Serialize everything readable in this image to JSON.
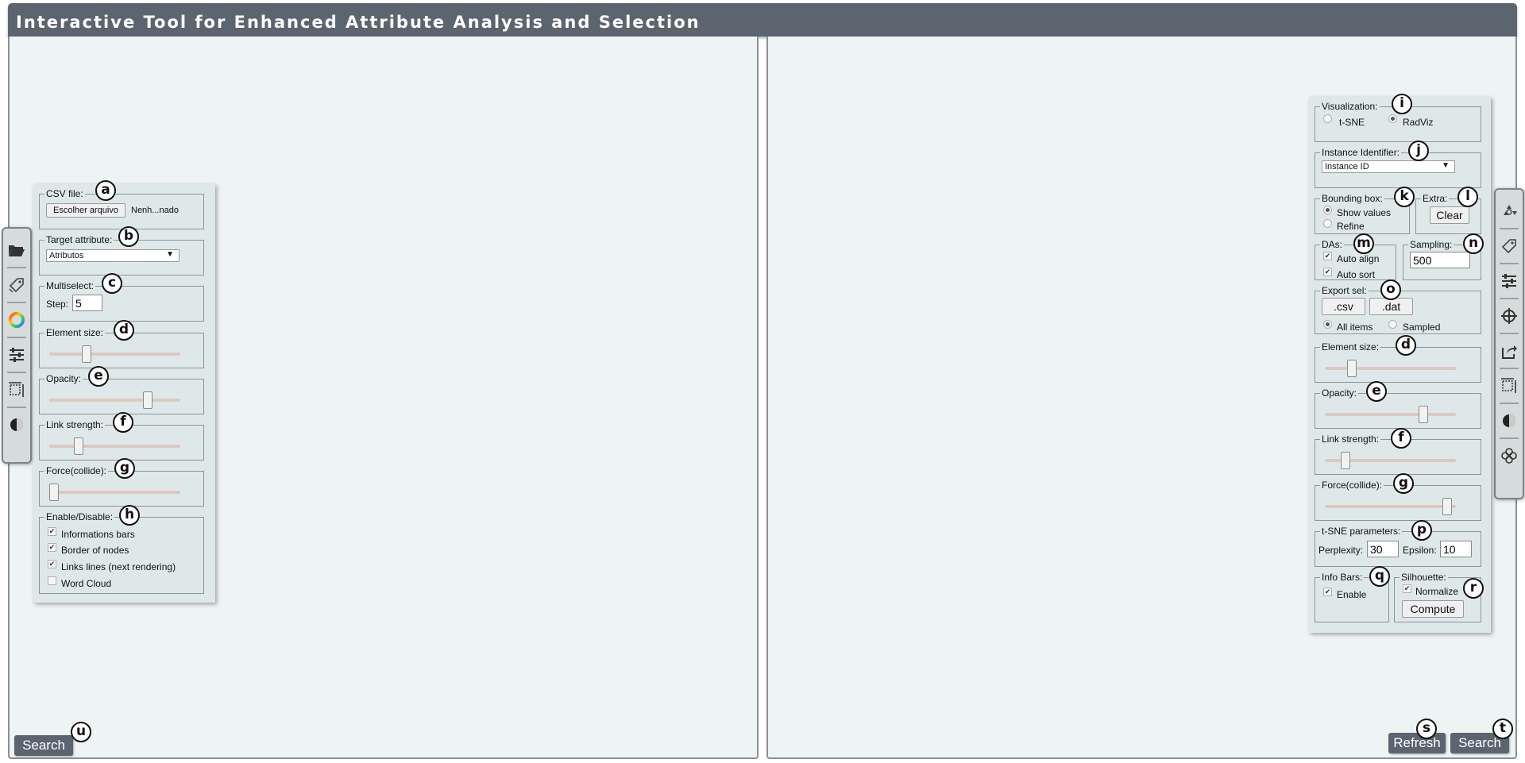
{
  "app": {
    "title": "Interactive Tool for Enhanced Attribute Analysis and Selection",
    "colors": {
      "titlebar": "#5c6470",
      "panel": "#eef3f3",
      "controls": "#dfe8e8"
    }
  },
  "left_toolbar": {
    "icons": [
      "folder-open-icon",
      "tag-icon",
      "color-wheel-icon",
      "sliders-icon",
      "resize-icon",
      "contrast-icon"
    ]
  },
  "right_toolbar": {
    "icons": [
      "recycle-icon",
      "tag-icon",
      "sliders-icon",
      "crosshair-icon",
      "share-icon",
      "resize-icon",
      "contrast-icon",
      "flower-icon"
    ]
  },
  "left_controls": {
    "csv": {
      "legend": "CSV file:",
      "button": "Escolher arquivo",
      "filename": "Nenh...nado",
      "marker": "a"
    },
    "target": {
      "legend": "Target attribute:",
      "selected": "Atributos",
      "marker": "b"
    },
    "multiselect": {
      "legend": "Multiselect:",
      "step_label": "Step:",
      "step_value": "5",
      "marker": "c"
    },
    "element_size": {
      "legend": "Element size:",
      "level": 0.27,
      "marker": "d"
    },
    "opacity": {
      "legend": "Opacity:",
      "level": 0.77,
      "marker": "e"
    },
    "link_strength": {
      "legend": "Link strength:",
      "level": 0.2,
      "marker": "f"
    },
    "force": {
      "legend": "Force(collide):",
      "level": 0.0,
      "marker": "g"
    },
    "enable": {
      "legend": "Enable/Disable:",
      "marker": "h",
      "items": [
        {
          "label": "Informations bars",
          "checked": true
        },
        {
          "label": "Border of nodes",
          "checked": true
        },
        {
          "label": "Links lines (next rendering)",
          "checked": true
        },
        {
          "label": "Word Cloud",
          "checked": false
        }
      ]
    }
  },
  "right_controls": {
    "visualization": {
      "legend": "Visualization:",
      "marker": "i",
      "options": [
        "t-SNE",
        "RadViz"
      ],
      "selected": "RadViz"
    },
    "instance": {
      "legend": "Instance Identifier:",
      "selected": "Instance ID",
      "marker": "j"
    },
    "bounding": {
      "legend": "Bounding box:",
      "marker": "k",
      "options": [
        "Show values",
        "Refine"
      ],
      "selected": "Show values"
    },
    "extra": {
      "legend": "Extra:",
      "button": "Clear",
      "marker": "l"
    },
    "das": {
      "legend": "DAs:",
      "marker": "m",
      "items": [
        {
          "label": "Auto align",
          "checked": true
        },
        {
          "label": "Auto sort",
          "checked": true
        }
      ]
    },
    "sampling": {
      "legend": "Sampling:",
      "value": "500",
      "marker": "n"
    },
    "export": {
      "legend": "Export sel:",
      "marker": "o",
      "buttons": [
        ".csv",
        ".dat"
      ],
      "options": [
        "All items",
        "Sampled"
      ],
      "selected": "All items"
    },
    "element_size": {
      "legend": "Element size:",
      "level": 0.18,
      "marker": "d"
    },
    "opacity": {
      "legend": "Opacity:",
      "level": 0.77,
      "marker": "e"
    },
    "link_strength": {
      "legend": "Link strength:",
      "level": 0.13,
      "marker": "f"
    },
    "force": {
      "legend": "Force(collide):",
      "level": 0.97,
      "marker": "g"
    },
    "tsne": {
      "legend": "t-SNE parameters:",
      "marker": "p",
      "perplexity_label": "Perplexity:",
      "perplexity": "30",
      "epsilon_label": "Epsilon:",
      "epsilon": "10"
    },
    "info_bars": {
      "legend": "Info Bars:",
      "marker": "q",
      "item": "Enable",
      "checked": true
    },
    "silhouette": {
      "legend": "Silhouette:",
      "marker": "r",
      "item": "Normalize",
      "checked": true,
      "button": "Compute"
    }
  },
  "bottom": {
    "left_search": "Search",
    "left_marker": "u",
    "refresh": "Refresh",
    "refresh_marker": "s",
    "right_search": "Search",
    "right_marker": "t"
  }
}
